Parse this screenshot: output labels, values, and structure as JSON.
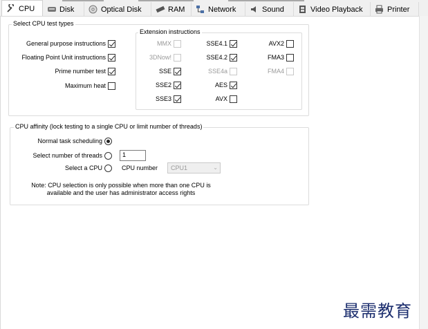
{
  "tabs": [
    {
      "label": "CPU",
      "icon": "wrench-icon",
      "active": true
    },
    {
      "label": "Disk",
      "icon": "disk-icon"
    },
    {
      "label": "Optical Disk",
      "icon": "optical-disc-icon"
    },
    {
      "label": "RAM",
      "icon": "ram-chip-icon"
    },
    {
      "label": "Network",
      "icon": "network-icon"
    },
    {
      "label": "Sound",
      "icon": "speaker-icon"
    },
    {
      "label": "Video Playback",
      "icon": "film-icon"
    },
    {
      "label": "Printer",
      "icon": "printer-icon"
    }
  ],
  "cpu_tests": {
    "title": "Select CPU test types",
    "items": [
      {
        "label": "General purpose instructions",
        "checked": true
      },
      {
        "label": "Floating Point Unit instructions",
        "checked": true
      },
      {
        "label": "Prime number test",
        "checked": true
      },
      {
        "label": "Maximum heat",
        "checked": false
      }
    ],
    "extensions": {
      "title": "Extension instructions",
      "items": [
        {
          "label": "MMX",
          "checked": false,
          "enabled": false
        },
        {
          "label": "SSE4.1",
          "checked": true,
          "enabled": true
        },
        {
          "label": "AVX2",
          "checked": false,
          "enabled": true
        },
        {
          "label": "3DNow!",
          "checked": false,
          "enabled": false
        },
        {
          "label": "SSE4.2",
          "checked": true,
          "enabled": true
        },
        {
          "label": "FMA3",
          "checked": false,
          "enabled": true
        },
        {
          "label": "SSE",
          "checked": true,
          "enabled": true
        },
        {
          "label": "SSE4a",
          "checked": false,
          "enabled": false
        },
        {
          "label": "FMA4",
          "checked": false,
          "enabled": false
        },
        {
          "label": "SSE2",
          "checked": true,
          "enabled": true
        },
        {
          "label": "AES",
          "checked": true,
          "enabled": true
        },
        {
          "label": "SSE3",
          "checked": true,
          "enabled": true
        },
        {
          "label": "AVX",
          "checked": false,
          "enabled": true
        }
      ]
    }
  },
  "affinity": {
    "title": "CPU affinity (lock testing to a single CPU or limit number of threads)",
    "normal_label": "Normal task scheduling",
    "threads_label": "Select number of threads",
    "threads_value": "1",
    "cpu_label": "Select a CPU",
    "cpu_number_label": "CPU number",
    "cpu_value": "CPU1",
    "selected": "normal",
    "note_line1": "Note: CPU selection is only possible when more than one CPU is",
    "note_line2": "available and the user has administrator access rights"
  },
  "watermark": "最需教育"
}
